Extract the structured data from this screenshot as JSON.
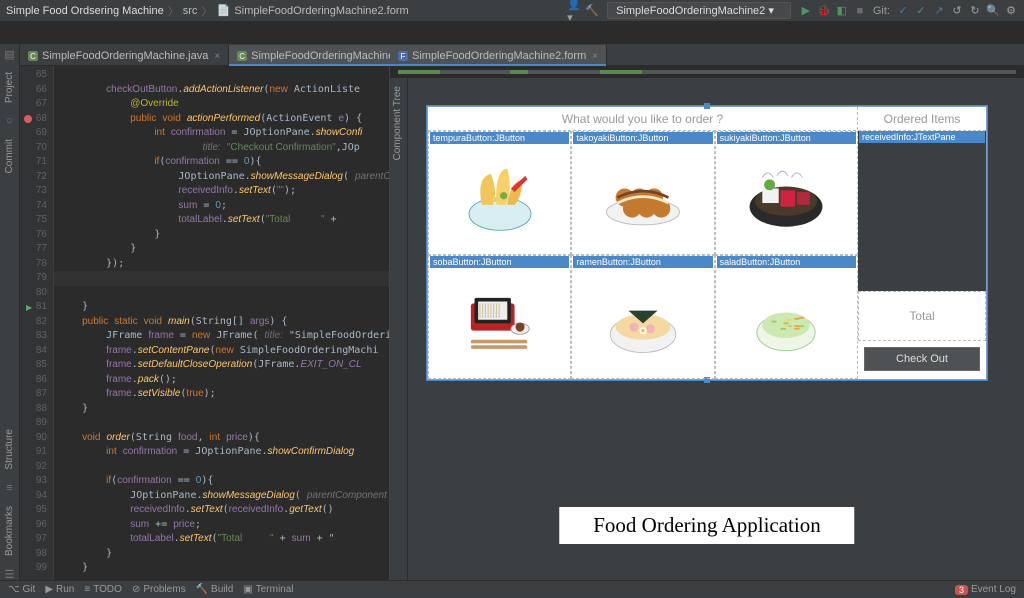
{
  "breadcrumb": {
    "project": "Simple Food Ordsering Machine",
    "folder": "src",
    "file": "SimpleFoodOrderingMachine2.form"
  },
  "toolbar": {
    "run_config": "SimpleFoodOrderingMachine2",
    "git_label": "Git:"
  },
  "tabs": {
    "left": [
      {
        "label": "SimpleFoodOrderingMachine.java",
        "icon": "java",
        "active": false
      },
      {
        "label": "SimpleFoodOrderingMachine2.java",
        "icon": "java",
        "active": true
      }
    ],
    "right": [
      {
        "label": "SimpleFoodOrderingMachine2.form",
        "icon": "form",
        "active": true
      }
    ]
  },
  "left_rail": {
    "project": "Project",
    "commit": "Commit",
    "structure": "Structure",
    "bookmarks": "Bookmarks"
  },
  "right_rail": {
    "component_tree": "Component Tree"
  },
  "gutter_start": 65,
  "code": {
    "lines": [
      "",
      "        checkOutButton.addActionListener(new ActionListe",
      "            @Override",
      "            public void actionPerformed(ActionEvent e) {",
      "                int confirmation = JOptionPane.showConfi",
      "                        title: \"Checkout Confirmation\",JOp",
      "                if(confirmation == 0){",
      "                    JOptionPane.showMessageDialog( parentC",
      "                    receivedInfo.setText(\"\");",
      "                    sum = 0;",
      "                    totalLabel.setText(\"Total           \" +",
      "                }",
      "            }",
      "        });",
      "",
      "    }",
      "    public static void main(String[] args) {",
      "        JFrame frame = new JFrame( title: \"SimpleFoodOrderi",
      "        frame.setContentPane(new SimpleFoodOrderingMachi",
      "        frame.setDefaultCloseOperation(JFrame.EXIT_ON_CL",
      "        frame.pack();",
      "        frame.setVisible(true);",
      "    }",
      "",
      "    void order(String food, int price){",
      "        int confirmation = JOptionPane.showConfirmDialog",
      "",
      "        if(confirmation == 0){",
      "            JOptionPane.showMessageDialog( parentComponent",
      "            receivedInfo.setText(receivedInfo.getText()",
      "            sum += price;",
      "            totalLabel.setText(\"Total          \" + sum + \"",
      "        }",
      "    }",
      ""
    ]
  },
  "form": {
    "prompt": "What would you like to order ?",
    "ordered_header": "Ordered Items",
    "total_label": "Total",
    "checkout_label": "Check Out",
    "received_tag": "receivedInfo:JTextPane",
    "buttons": [
      {
        "tag": "tempuraButton:JButton",
        "food": "tempura"
      },
      {
        "tag": "takoyakiButton:JButton",
        "food": "takoyaki"
      },
      {
        "tag": "sukiyakiButton:JButton",
        "food": "sukiyaki"
      },
      {
        "tag": "sobaButton:JButton",
        "food": "soba"
      },
      {
        "tag": "ramenButton:JButton",
        "food": "ramen"
      },
      {
        "tag": "saladButton:JButton",
        "food": "salad"
      }
    ]
  },
  "caption": "Food Ordering Application",
  "status": {
    "git": "Git",
    "run": "Run",
    "todo": "TODO",
    "problems": "Problems",
    "build": "Build",
    "terminal": "Terminal",
    "event_log": "Event Log",
    "event_count": "3"
  }
}
